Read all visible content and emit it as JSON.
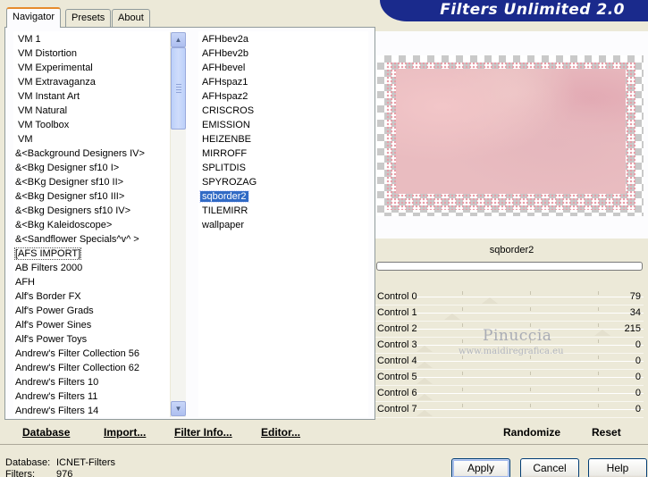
{
  "app": {
    "title": "Filters Unlimited 2.0"
  },
  "tabs": [
    {
      "label": "Navigator",
      "active": true
    },
    {
      "label": "Presets",
      "active": false
    },
    {
      "label": "About",
      "active": false
    }
  ],
  "categories": {
    "items": [
      "VM 1",
      "VM Distortion",
      "VM Experimental",
      "VM Extravaganza",
      "VM Instant Art",
      "VM Natural",
      "VM Toolbox",
      "VM",
      "&<Background Designers IV>",
      "&<Bkg Designer sf10 I>",
      "&<BKg Designer sf10 II>",
      "&<Bkg Designer sf10 III>",
      "&<Bkg Designers sf10 IV>",
      "&<Bkg Kaleidoscope>",
      "&<Sandflower Specials^v^ >",
      "[AFS IMPORT]",
      "AB Filters 2000",
      "AFH",
      "Alf's Border FX",
      "Alf's Power Grads",
      "Alf's Power Sines",
      "Alf's Power Toys",
      "Andrew's Filter Collection 56",
      "Andrew's Filter Collection 62",
      "Andrew's Filters 10",
      "Andrew's Filters 11",
      "Andrew's Filters 14"
    ]
  },
  "filters": {
    "items": [
      "AFHbev2a",
      "AFHbev2b",
      "AFHbevel",
      "AFHspaz1",
      "AFHspaz2",
      "CRISCROS",
      "EMISSION",
      "HEIZENBE",
      "MIRROFF",
      "SPLITDIS",
      "SPYROZAG",
      "sqborder2",
      "TILEMIRR",
      "wallpaper"
    ],
    "selected_index": 11
  },
  "left_buttons": {
    "database": "Database",
    "import": "Import...",
    "filter_info": "Filter Info...",
    "editor": "Editor..."
  },
  "preview": {
    "filter_name": "sqborder2"
  },
  "controls": [
    {
      "label": "Control 0",
      "value": "79",
      "level": 79
    },
    {
      "label": "Control 1",
      "value": "34",
      "level": 34
    },
    {
      "label": "Control 2",
      "value": "215",
      "level": 215
    },
    {
      "label": "Control 3",
      "value": "0",
      "level": 0
    },
    {
      "label": "Control 4",
      "value": "0",
      "level": 0
    },
    {
      "label": "Control 5",
      "value": "0",
      "level": 0
    },
    {
      "label": "Control 6",
      "value": "0",
      "level": 0
    },
    {
      "label": "Control 7",
      "value": "0",
      "level": 0
    }
  ],
  "control_max": 255,
  "right_buttons": {
    "randomize": "Randomize",
    "reset": "Reset"
  },
  "watermark": {
    "name": "Pinuccia",
    "url": "www.maidiregrafica.eu"
  },
  "footer": {
    "database_label": "Database:",
    "database_value": "ICNET-Filters",
    "filters_label": "Filters:",
    "filters_value": "976"
  },
  "dialog_buttons": {
    "apply": "Apply",
    "cancel": "Cancel",
    "help": "Help"
  }
}
